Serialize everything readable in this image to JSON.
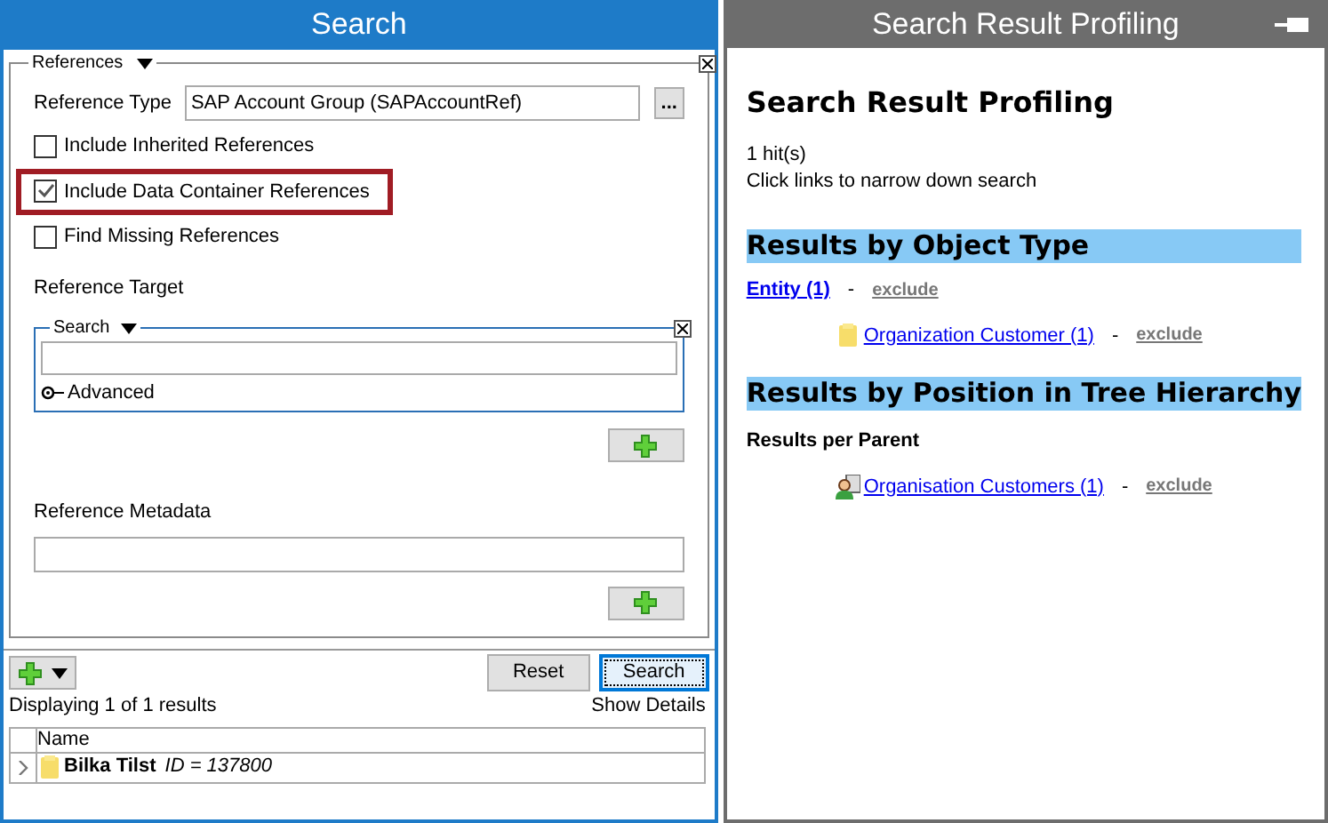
{
  "search_panel": {
    "title": "Search",
    "references": {
      "legend": "References",
      "reference_type_label": "Reference Type",
      "reference_type_value": "SAP Account Group (SAPAccountRef)",
      "browse_button": "...",
      "checkboxes": [
        {
          "label": "Include Inherited References",
          "checked": false,
          "highlighted": false
        },
        {
          "label": "Include Data  Container References",
          "checked": true,
          "highlighted": true
        },
        {
          "label": "Find Missing References",
          "checked": false,
          "highlighted": false
        }
      ],
      "target_label": "Reference Target",
      "target_search": {
        "legend": "Search",
        "advanced": "Advanced"
      },
      "metadata_label": "Reference Metadata"
    },
    "buttons": [
      {
        "label": "Reset",
        "selected": false
      },
      {
        "label": "Search",
        "selected": true
      }
    ],
    "result_count": "Displaying 1 of 1 results",
    "show_details": "Show Details",
    "table": {
      "columns": [
        "Name"
      ],
      "rows": [
        {
          "name": "Bilka Tilst",
          "id": "ID = 137800",
          "expanded": false
        }
      ]
    }
  },
  "profiling_panel": {
    "title": "Search Result Profiling",
    "heading": "Search Result Profiling",
    "hits": "1 hit(s)",
    "hint": "Click links to narrow down search",
    "sections": [
      {
        "title": "Results by Object Type",
        "groups": [
          {
            "link": "Entity (1)",
            "separator": "-",
            "exclude": "exclude",
            "items": [
              {
                "kind": "folder",
                "link": "Organization Customer (1)",
                "separator": "-",
                "exclude": "exclude"
              }
            ]
          }
        ]
      },
      {
        "title": "Results by Position in Tree Hierarchy",
        "subtitle": "Results per Parent",
        "groups": [
          {
            "items": [
              {
                "kind": "person",
                "link": "Organisation Customers (1)",
                "separator": "-",
                "exclude": "exclude"
              }
            ]
          }
        ]
      }
    ]
  }
}
